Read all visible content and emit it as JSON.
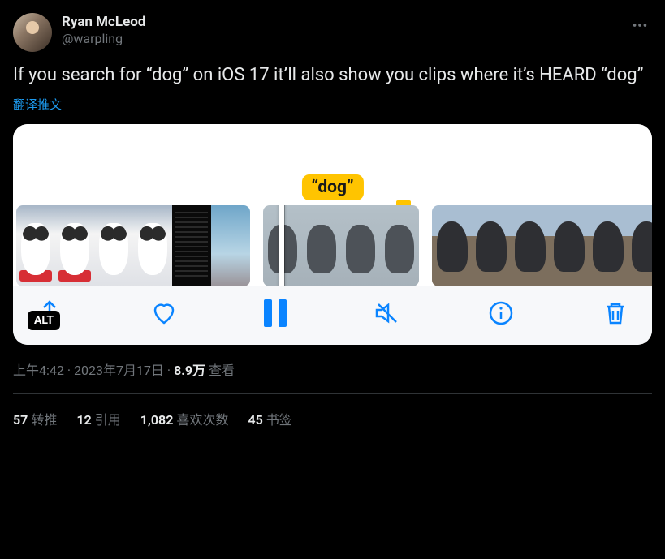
{
  "author": {
    "display_name": "Ryan McLeod",
    "handle": "@warpling"
  },
  "body": "If you search for “dog” on iOS 17 it’ll also show you clips where it’s HEARD “dog”",
  "translate_label": "翻译推文",
  "media": {
    "search_tag": "“dog”",
    "alt_badge": "ALT"
  },
  "meta": {
    "time": "上午4:42",
    "dot": " · ",
    "date": "2023年7月17日",
    "views_value": "8.9万",
    "views_label": "查看"
  },
  "counts": {
    "retweets": {
      "value": "57",
      "label": "转推"
    },
    "quotes": {
      "value": "12",
      "label": "引用"
    },
    "likes": {
      "value": "1,082",
      "label": "喜欢次数"
    },
    "bookmarks": {
      "value": "45",
      "label": "书签"
    }
  }
}
